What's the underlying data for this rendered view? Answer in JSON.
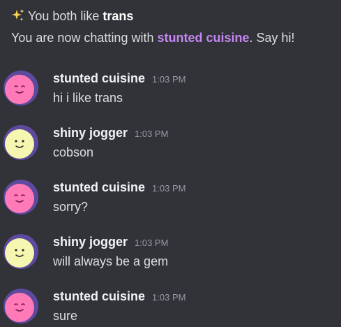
{
  "header": {
    "like_prefix": "You both like",
    "like_topic": "trans",
    "chat_prefix": "You are now chatting with",
    "chat_partner": "stunted cuisine",
    "chat_suffix": ". Say hi!"
  },
  "messages": [
    {
      "author": "stunted cuisine",
      "time": "1:03 PM",
      "text": "hi i like trans",
      "avatar": "pink-face"
    },
    {
      "author": "shiny jogger",
      "time": "1:03 PM",
      "text": "cobson",
      "avatar": "yellow-face"
    },
    {
      "author": "stunted cuisine",
      "time": "1:03 PM",
      "text": "sorry?",
      "avatar": "pink-face"
    },
    {
      "author": "shiny jogger",
      "time": "1:03 PM",
      "text": "will always be a gem",
      "avatar": "yellow-face"
    },
    {
      "author": "stunted cuisine",
      "time": "1:03 PM",
      "text": "sure",
      "avatar": "pink-face"
    }
  ],
  "colors": {
    "background": "#313338",
    "accent_name": "#c586f2",
    "avatar_ring": "#5d4a9e",
    "pink_face": "#ff7ab6",
    "yellow_face": "#f5f7b0"
  }
}
